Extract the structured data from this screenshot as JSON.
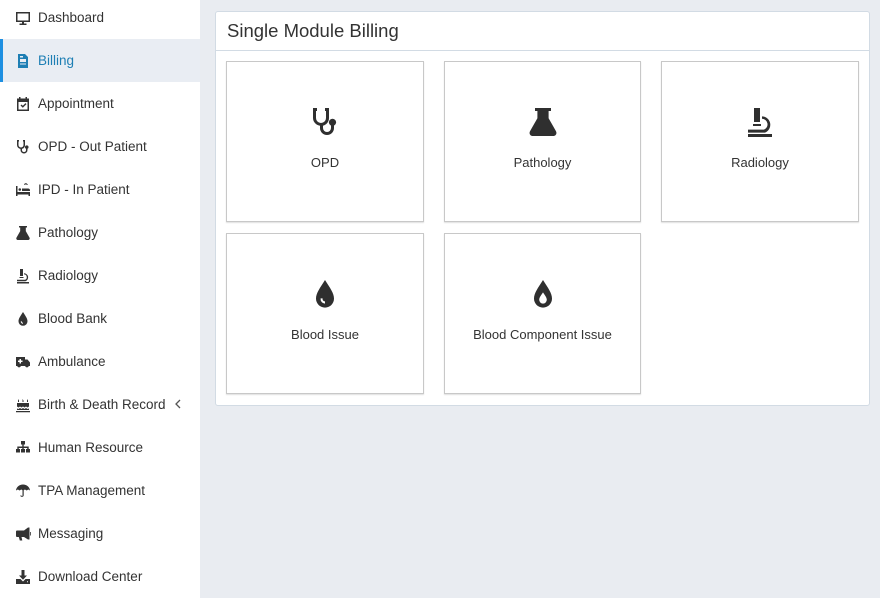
{
  "sidebar": {
    "active_color": "#1d8fe1",
    "items": [
      {
        "label": "Dashboard",
        "icon": "monitor-icon"
      },
      {
        "label": "Billing",
        "icon": "document-icon",
        "active": true
      },
      {
        "label": "Appointment",
        "icon": "calendar-check-icon"
      },
      {
        "label": "OPD - Out Patient",
        "icon": "stethoscope-icon"
      },
      {
        "label": "IPD - In Patient",
        "icon": "bed-icon"
      },
      {
        "label": "Pathology",
        "icon": "flask-icon"
      },
      {
        "label": "Radiology",
        "icon": "microscope-icon"
      },
      {
        "label": "Blood Bank",
        "icon": "blood-drop-icon"
      },
      {
        "label": "Ambulance",
        "icon": "ambulance-icon"
      },
      {
        "label": "Birth & Death Record",
        "icon": "birthday-cake-icon",
        "has_submenu": true
      },
      {
        "label": "Human Resource",
        "icon": "sitemap-icon"
      },
      {
        "label": "TPA Management",
        "icon": "umbrella-icon"
      },
      {
        "label": "Messaging",
        "icon": "bullhorn-icon"
      },
      {
        "label": "Download Center",
        "icon": "download-icon"
      }
    ]
  },
  "main": {
    "title": "Single Module Billing",
    "tiles": [
      {
        "label": "OPD",
        "icon": "stethoscope-icon"
      },
      {
        "label": "Pathology",
        "icon": "flask-icon"
      },
      {
        "label": "Radiology",
        "icon": "microscope-icon"
      },
      {
        "label": "Blood Issue",
        "icon": "blood-drop-icon"
      },
      {
        "label": "Blood Component Issue",
        "icon": "blood-drop-outline-icon"
      }
    ]
  }
}
